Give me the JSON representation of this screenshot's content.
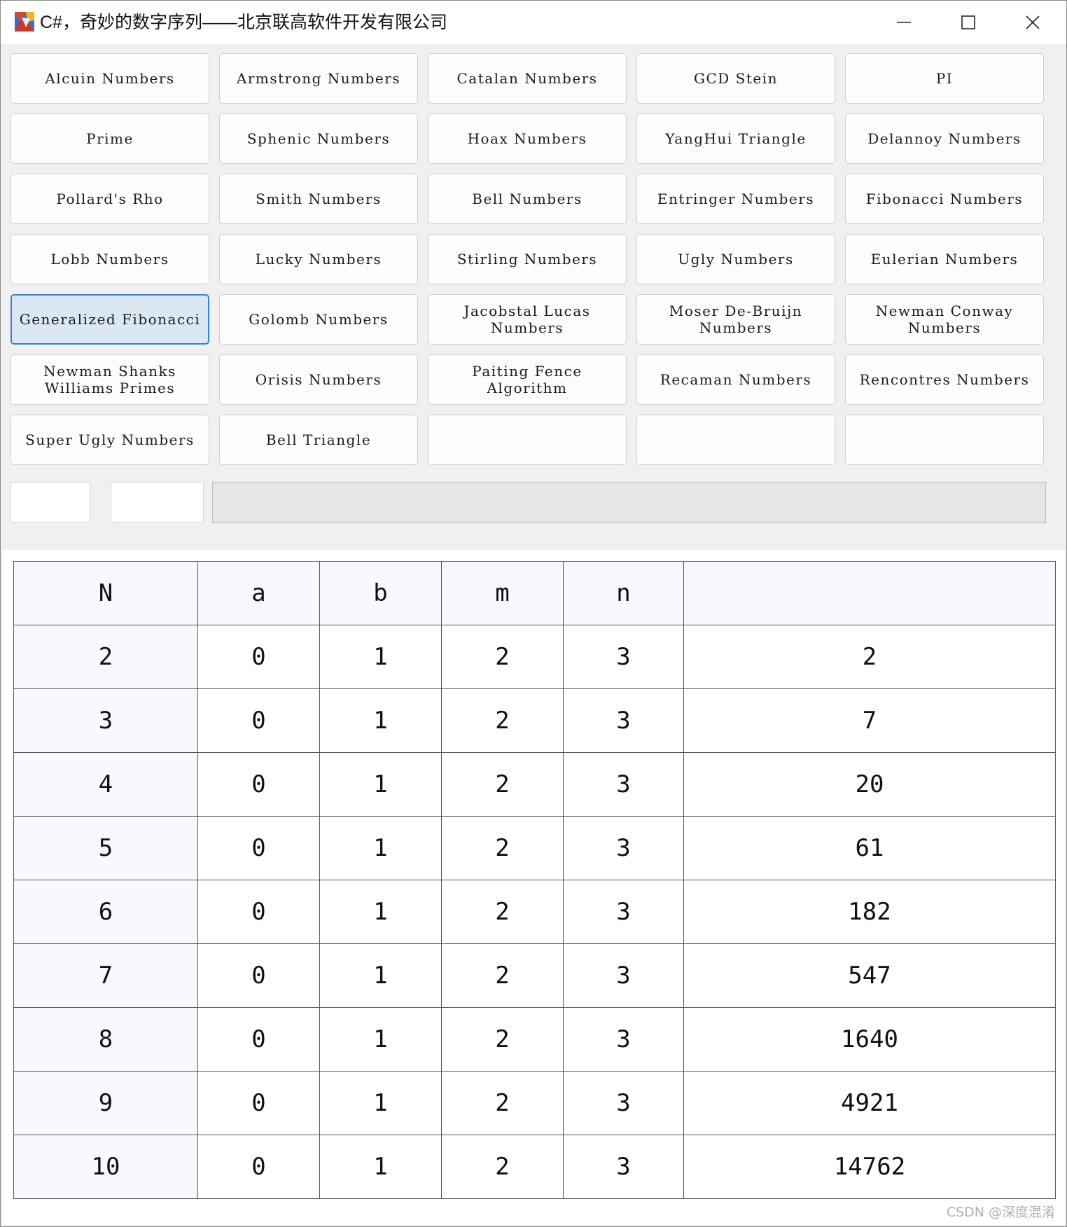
{
  "window": {
    "title": "C#，奇妙的数字序列——北京联高软件开发有限公司",
    "icon": "app-logo-icon",
    "controls": [
      "minimize-icon",
      "maximize-icon",
      "close-icon"
    ]
  },
  "buttons": [
    "Alcuin Numbers",
    "Armstrong Numbers",
    "Catalan Numbers",
    "GCD Stein",
    "PI",
    "Prime",
    "Sphenic Numbers",
    "Hoax Numbers",
    "YangHui Triangle",
    "Delannoy Numbers",
    "Pollard's Rho",
    "Smith Numbers",
    "Bell Numbers",
    "Entringer Numbers",
    "Fibonacci Numbers",
    "Lobb Numbers",
    "Lucky Numbers",
    "Stirling Numbers",
    "Ugly Numbers",
    "Eulerian Numbers",
    "Generalized Fibonacci",
    "Golomb Numbers",
    "Jacobstal Lucas Numbers",
    "Moser De-Bruijn Numbers",
    "Newman Conway Numbers",
    "Newman Shanks Williams Primes",
    "Orisis Numbers",
    "Paiting Fence Algorithm",
    "Recaman Numbers",
    "Rencontres Numbers",
    "Super Ugly Numbers",
    "Bell Triangle",
    "",
    "",
    ""
  ],
  "selected_button": "Generalized Fibonacci",
  "inputs": {
    "box1_value": "",
    "box2_value": ""
  },
  "progress": {
    "value": 0
  },
  "table": {
    "headers": [
      "N",
      "a",
      "b",
      "m",
      "n",
      ""
    ],
    "rows": [
      [
        "2",
        "0",
        "1",
        "2",
        "3",
        "2"
      ],
      [
        "3",
        "0",
        "1",
        "2",
        "3",
        "7"
      ],
      [
        "4",
        "0",
        "1",
        "2",
        "3",
        "20"
      ],
      [
        "5",
        "0",
        "1",
        "2",
        "3",
        "61"
      ],
      [
        "6",
        "0",
        "1",
        "2",
        "3",
        "182"
      ],
      [
        "7",
        "0",
        "1",
        "2",
        "3",
        "547"
      ],
      [
        "8",
        "0",
        "1",
        "2",
        "3",
        "1640"
      ],
      [
        "9",
        "0",
        "1",
        "2",
        "3",
        "4921"
      ],
      [
        "10",
        "0",
        "1",
        "2",
        "3",
        "14762"
      ]
    ]
  },
  "watermark": "CSDN @深度混淆"
}
